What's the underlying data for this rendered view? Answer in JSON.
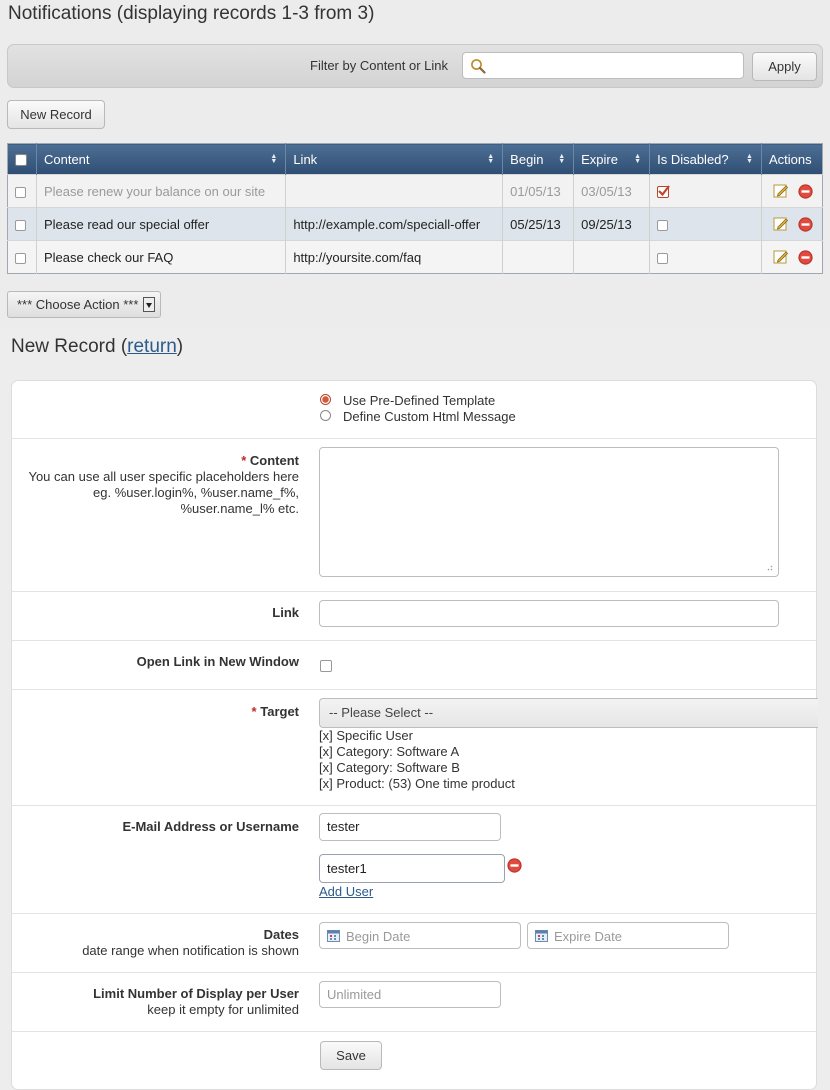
{
  "page_title": "Notifications (displaying records 1-3 from 3)",
  "filter": {
    "label": "Filter by Content or Link",
    "value": "",
    "apply_label": "Apply"
  },
  "new_record_label": "New Record",
  "grid": {
    "columns": [
      "Content",
      "Link",
      "Begin",
      "Expire",
      "Is Disabled?",
      "Actions"
    ],
    "rows": [
      {
        "content": "Please renew your balance on our site",
        "link": "",
        "begin": "01/05/13",
        "expire": "03/05/13",
        "disabled": true
      },
      {
        "content": "Please read our special offer",
        "link": "http://example.com/speciall-offer",
        "begin": "05/25/13",
        "expire": "09/25/13",
        "disabled": false
      },
      {
        "content": "Please check our FAQ",
        "link": "http://yoursite.com/faq",
        "begin": "",
        "expire": "",
        "disabled": false
      }
    ]
  },
  "choose_action_label": "*** Choose Action ***",
  "form": {
    "title": "New Record",
    "return_link": "return",
    "template_options": [
      "Use Pre-Defined Template",
      "Define Custom Html Message"
    ],
    "content_label": "Content",
    "content_hint": "You can use all user specific placeholders here eg. %user.login%, %user.name_f%, %user.name_l% etc.",
    "link_label": "Link",
    "open_new_window_label": "Open Link in New Window",
    "target_label": "Target",
    "target_select": "-- Please Select --",
    "target_remove_mark": "[x]",
    "target_items": [
      "Specific User",
      "Category: Software A",
      "Category: Software B",
      "Product: (53) One time product"
    ],
    "email_label": "E-Mail Address or Username",
    "email_values": [
      "tester",
      "tester1"
    ],
    "add_user_label": "Add User",
    "dates_label": "Dates",
    "dates_hint": "date range when notification is shown",
    "begin_placeholder": "Begin Date",
    "expire_placeholder": "Expire Date",
    "limit_label": "Limit Number of Display per User",
    "limit_hint": "keep it empty for unlimited",
    "limit_placeholder": "Unlimited",
    "save_label": "Save"
  }
}
